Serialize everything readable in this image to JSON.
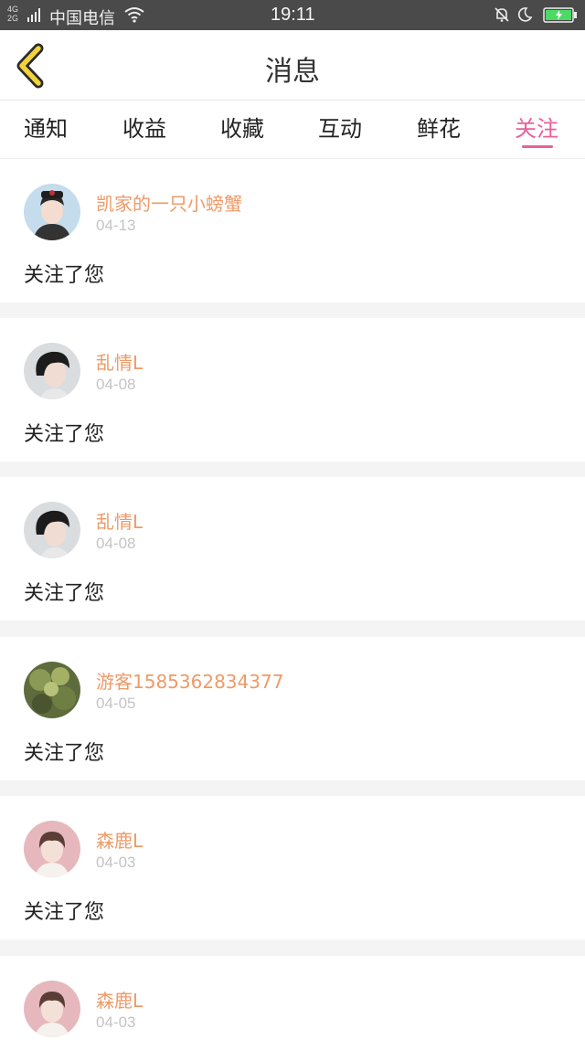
{
  "status_bar": {
    "network": "4G",
    "network2": "2G",
    "carrier": "中国电信",
    "time": "19:11"
  },
  "header": {
    "title": "消息"
  },
  "tabs": [
    {
      "label": "通知"
    },
    {
      "label": "收益"
    },
    {
      "label": "收藏"
    },
    {
      "label": "互动"
    },
    {
      "label": "鲜花"
    },
    {
      "label": "关注",
      "active": true
    }
  ],
  "colors": {
    "accent": "#e8609a",
    "username": "#ee9a68",
    "back_arrow": "#f2d43a"
  },
  "notifications": [
    {
      "name": "凯家的一只小螃蟹",
      "date": "04-13",
      "message": "关注了您",
      "avatar": "avatar-boy-cap"
    },
    {
      "name": "乱情L",
      "date": "04-08",
      "message": "关注了您",
      "avatar": "avatar-boy-dark"
    },
    {
      "name": "乱情L",
      "date": "04-08",
      "message": "关注了您",
      "avatar": "avatar-boy-dark"
    },
    {
      "name": "游客1585362834377",
      "date": "04-05",
      "message": "关注了您",
      "avatar": "avatar-plant"
    },
    {
      "name": "森鹿L",
      "date": "04-03",
      "message": "关注了您",
      "avatar": "avatar-boy-pink"
    },
    {
      "name": "森鹿L",
      "date": "04-03",
      "message": "",
      "avatar": "avatar-boy-pink"
    }
  ]
}
